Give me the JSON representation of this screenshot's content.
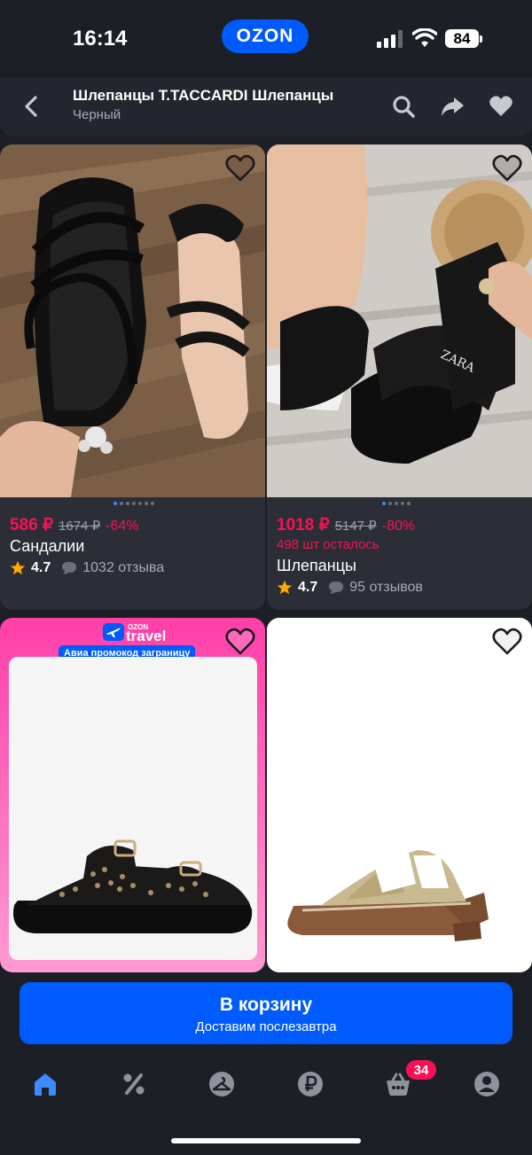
{
  "status_bar": {
    "time": "16:14",
    "carrier_badge": "OZON",
    "battery": "84"
  },
  "header": {
    "title": "Шлепанцы T.TACCARDI Шлепанцы",
    "subtitle": "Черный",
    "icons": [
      "back-icon",
      "search-icon",
      "share-icon",
      "heart-icon"
    ]
  },
  "products": [
    {
      "price": "586 ₽",
      "old_price": "1674 ₽",
      "discount": "-64%",
      "name": "Сандалии",
      "rating": "4.7",
      "reviews": "1032 отзыва"
    },
    {
      "price": "1018 ₽",
      "old_price": "5147 ₽",
      "discount": "-80%",
      "stock": "498 шт осталось",
      "name": "Шлепанцы",
      "rating": "4.7",
      "reviews": "95 отзывов"
    },
    {
      "promo_brand_top": "OZON",
      "promo_brand": "travel",
      "promo_text": "Авиа промокод заграницу"
    },
    {}
  ],
  "cart_button": {
    "label": "В корзину",
    "sublabel": "Доставим послезавтра"
  },
  "tab_bar": {
    "items": [
      "home-icon",
      "percent-icon",
      "hanger-icon",
      "ruble-icon",
      "basket-icon",
      "profile-icon"
    ],
    "cart_badge": "34"
  },
  "colors": {
    "accent": "#005bff",
    "price": "#f91155",
    "background": "#1c1f26",
    "card": "#2b2e36"
  }
}
